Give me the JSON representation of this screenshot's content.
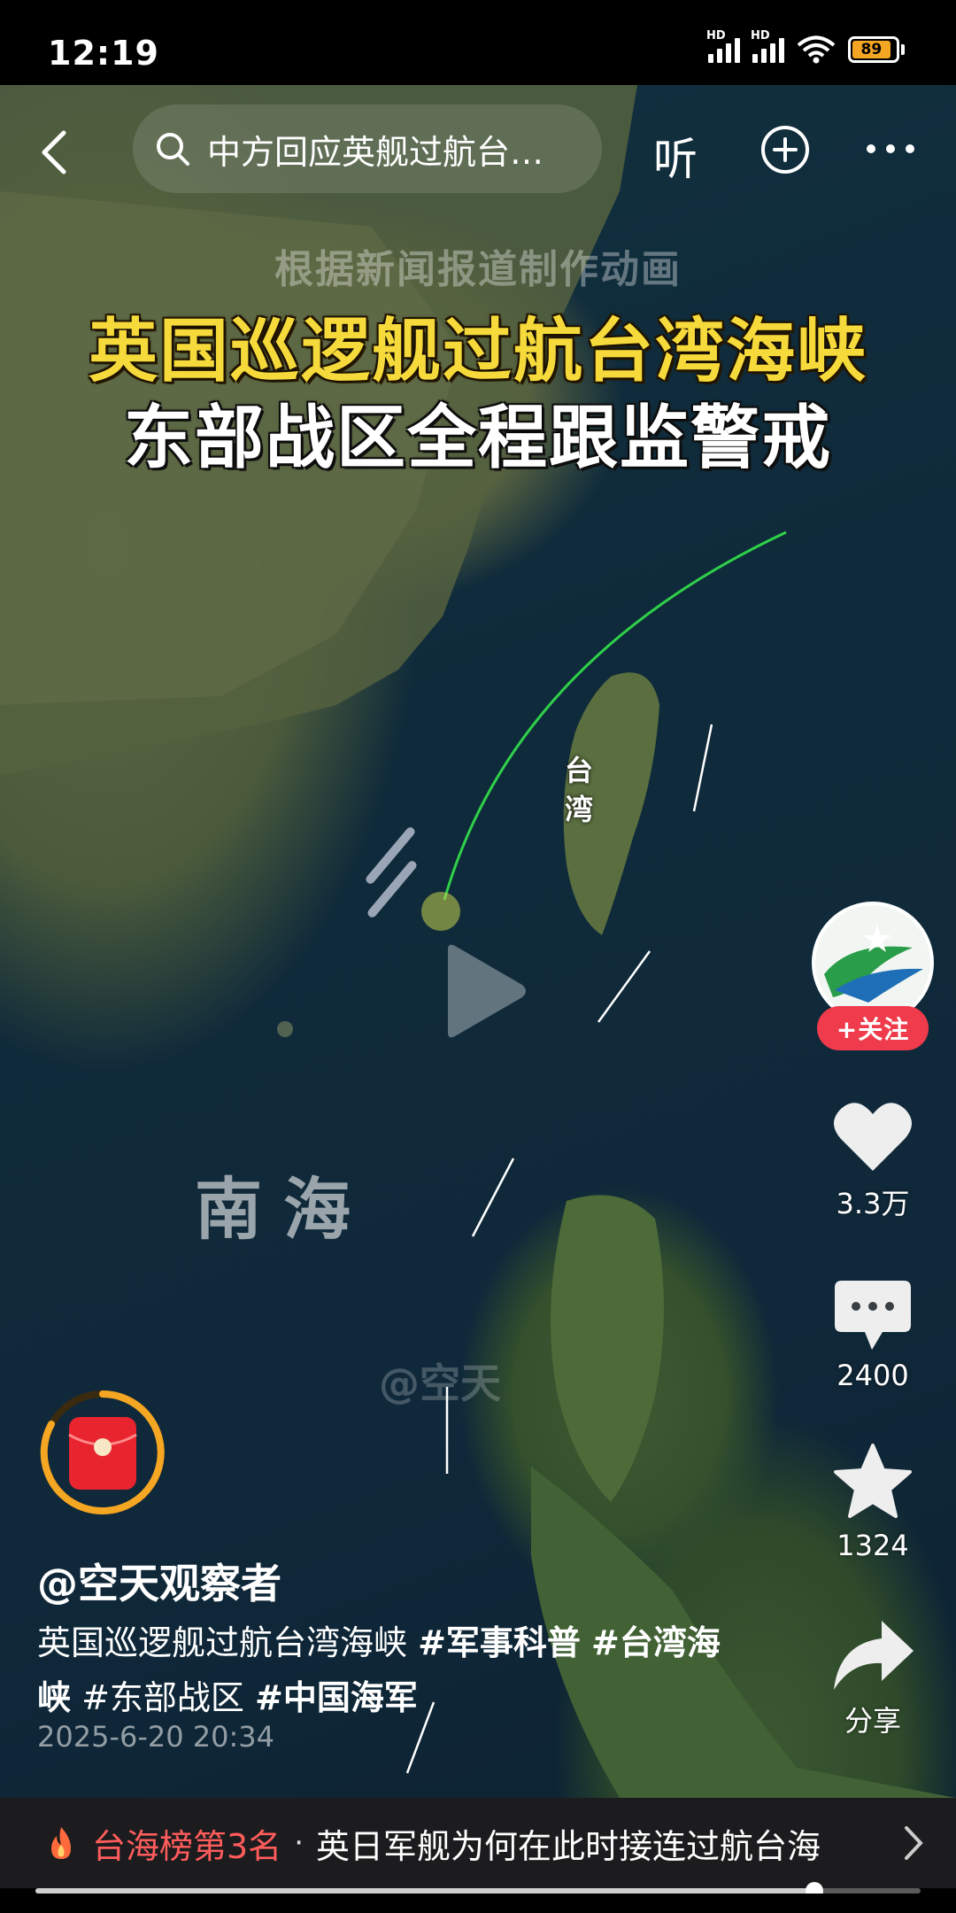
{
  "status_bar": {
    "time": "12:19",
    "signal_label": "HD",
    "battery": "89",
    "battery_color": "#f5a623"
  },
  "top_bar": {
    "search_text": "中方回应英舰过航台…",
    "listen_label": "听",
    "icons": [
      "back-arrow-icon",
      "search-icon",
      "add-circle-icon",
      "more-icon"
    ]
  },
  "video": {
    "watermark_top": "根据新闻报道制作动画",
    "headline_line1": "英国巡逻舰过航台湾海峡",
    "headline_line2": "东部战区全程跟监警戒",
    "label_taiwan": "台湾",
    "label_south_sea": "南海",
    "watermark_author": "@空天",
    "play_icon": "play-icon"
  },
  "actions": {
    "follow_label": "+关注",
    "likes": "3.3万",
    "comments": "2400",
    "favorites": "1324",
    "share_label": "分享",
    "accent": "#ef3b4b"
  },
  "post": {
    "author": "@空天观察者",
    "caption_text": "英国巡逻舰过航台湾海峡 ",
    "tag1": "#军事科普",
    "tag2": "#台湾海峡",
    "caption_rest": " #东部战区 ",
    "tag3": "#中国海军",
    "date": "2025-6-20 20:34"
  },
  "hot_bar": {
    "rank": "台海榜第3名",
    "separator": "·",
    "topic": "英日军舰为何在此时接连过航台海",
    "rank_color": "#ff5c5c"
  },
  "player": {
    "progress": 0.88
  }
}
